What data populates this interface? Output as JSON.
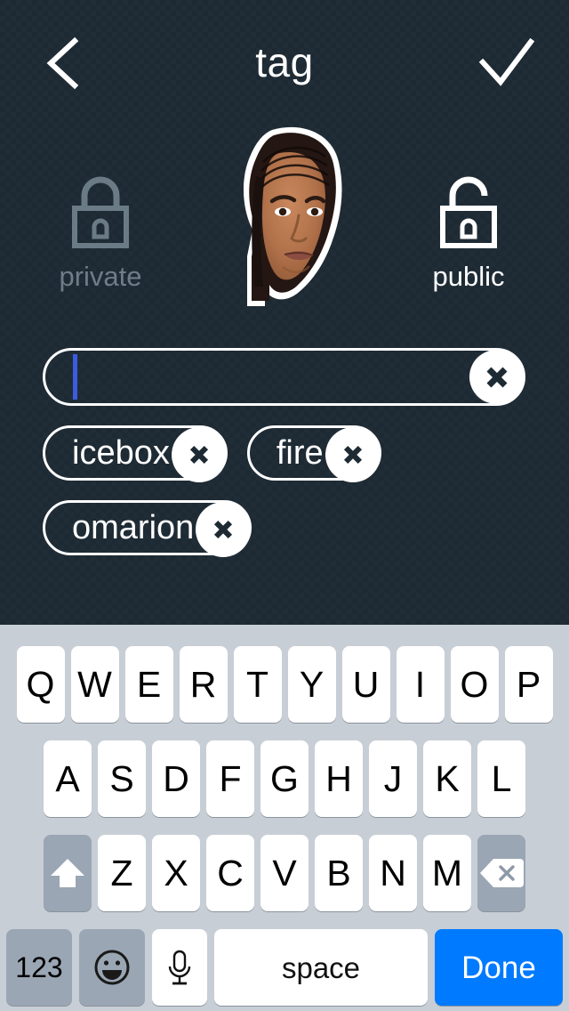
{
  "header": {
    "title": "tag",
    "back_icon": "chevron-left-icon",
    "confirm_icon": "check-icon"
  },
  "privacy": {
    "private": {
      "label": "private",
      "icon": "lock-closed-icon",
      "selected": false,
      "color": "#6f7d88"
    },
    "public": {
      "label": "public",
      "icon": "lock-open-icon",
      "selected": true,
      "color": "#ffffff"
    }
  },
  "sticker": {
    "name": "head-cutout-sticker"
  },
  "tag_input": {
    "value": "",
    "placeholder": "",
    "clear_icon": "close-circle-icon",
    "caret_color": "#3c5ce0"
  },
  "tags": [
    [
      {
        "label": "icebox",
        "remove_icon": "close-circle-icon"
      },
      {
        "label": "fire",
        "remove_icon": "close-circle-icon"
      }
    ],
    [
      {
        "label": "omarion",
        "remove_icon": "close-circle-icon"
      }
    ]
  ],
  "keyboard": {
    "row1": [
      "Q",
      "W",
      "E",
      "R",
      "T",
      "Y",
      "U",
      "I",
      "O",
      "P"
    ],
    "row2": [
      "A",
      "S",
      "D",
      "F",
      "G",
      "H",
      "J",
      "K",
      "L"
    ],
    "row3": [
      "Z",
      "X",
      "C",
      "V",
      "B",
      "N",
      "M"
    ],
    "shift_icon": "shift-up-arrow-icon",
    "backspace_icon": "backspace-delete-icon",
    "numbers_label": "123",
    "emoji_icon": "smiley-face-icon",
    "mic_icon": "microphone-icon",
    "space_label": "space",
    "done_label": "Done",
    "done_color": "#007aff",
    "background_color": "#c8ced6",
    "key_color": "#ffffff",
    "modifier_key_color": "#9aa6b3"
  },
  "colors": {
    "background": "#1d2a33",
    "foreground": "#ffffff"
  }
}
